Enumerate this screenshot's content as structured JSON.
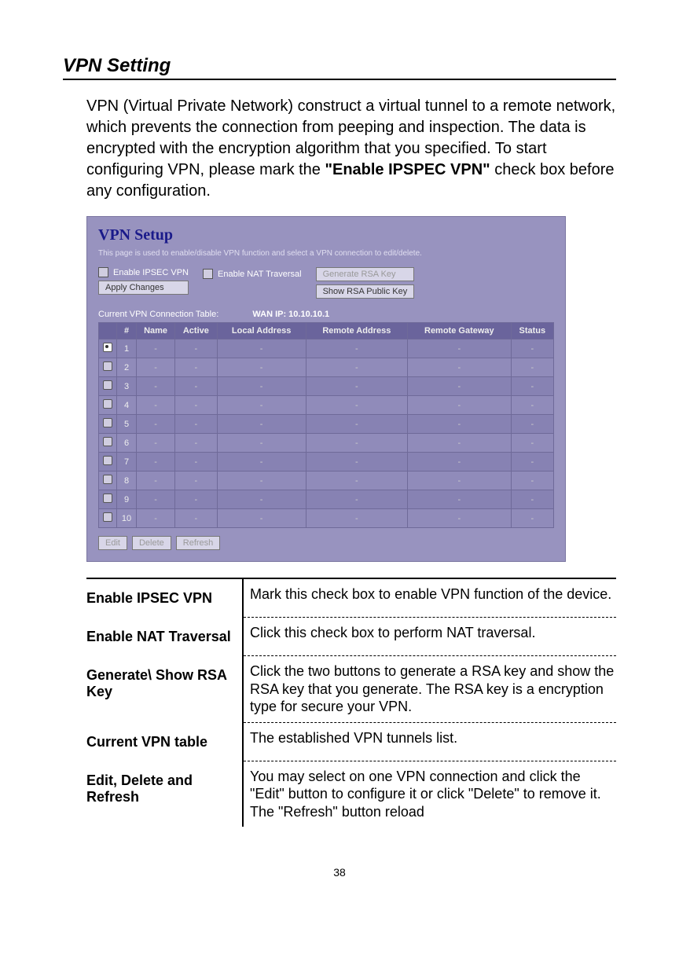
{
  "page": {
    "section_title": "VPN Setting",
    "number": "38"
  },
  "intro": {
    "pre": "VPN (Virtual Private Network) construct a virtual tunnel to a remote network, which prevents the connection from peeping and inspection. The data is encrypted with the encryption algorithm that you specified. To start configuring VPN, please mark the ",
    "bold": "\"Enable IPSPEC VPN\"",
    "post": " check box before any configuration."
  },
  "panel": {
    "title": "VPN Setup",
    "desc": "This page is used to enable/disable VPN function and select a VPN connection to edit/delete.",
    "checkbox_ipsec": "Enable IPSEC VPN",
    "checkbox_nat": "Enable NAT Traversal",
    "apply_label": "Apply Changes",
    "generate_label": "Generate RSA Key",
    "show_label": "Show RSA Public Key",
    "table_caption": "Current VPN Connection Table:",
    "wan_label": "WAN IP: 10.10.10.1",
    "headers": {
      "num": "#",
      "name": "Name",
      "active": "Active",
      "local": "Local Address",
      "remote": "Remote Address",
      "gateway": "Remote Gateway",
      "status": "Status"
    },
    "rows": [
      {
        "n": "1",
        "sel": true
      },
      {
        "n": "2"
      },
      {
        "n": "3"
      },
      {
        "n": "4"
      },
      {
        "n": "5"
      },
      {
        "n": "6"
      },
      {
        "n": "7"
      },
      {
        "n": "8"
      },
      {
        "n": "9"
      },
      {
        "n": "10"
      }
    ],
    "edit_label": "Edit",
    "delete_label": "Delete",
    "refresh_label": "Refresh"
  },
  "desc": [
    {
      "term": "Enable IPSEC VPN",
      "text": "Mark this check box to enable VPN function of the device."
    },
    {
      "term": "Enable NAT Traversal",
      "text": "Click this check box to perform NAT traversal."
    },
    {
      "term": "Generate\\ Show RSA Key",
      "text": "Click the two buttons to generate a RSA key and show the RSA key that you generate. The RSA key is a encryption type for secure your VPN."
    },
    {
      "term": "Current VPN table",
      "text": "The established VPN tunnels list."
    },
    {
      "term": "Edit, Delete and Refresh",
      "text": "You may select on one VPN connection and click the \"Edit\" button to configure it or click \"Delete\" to remove it. The \"Refresh\" button reload"
    }
  ]
}
